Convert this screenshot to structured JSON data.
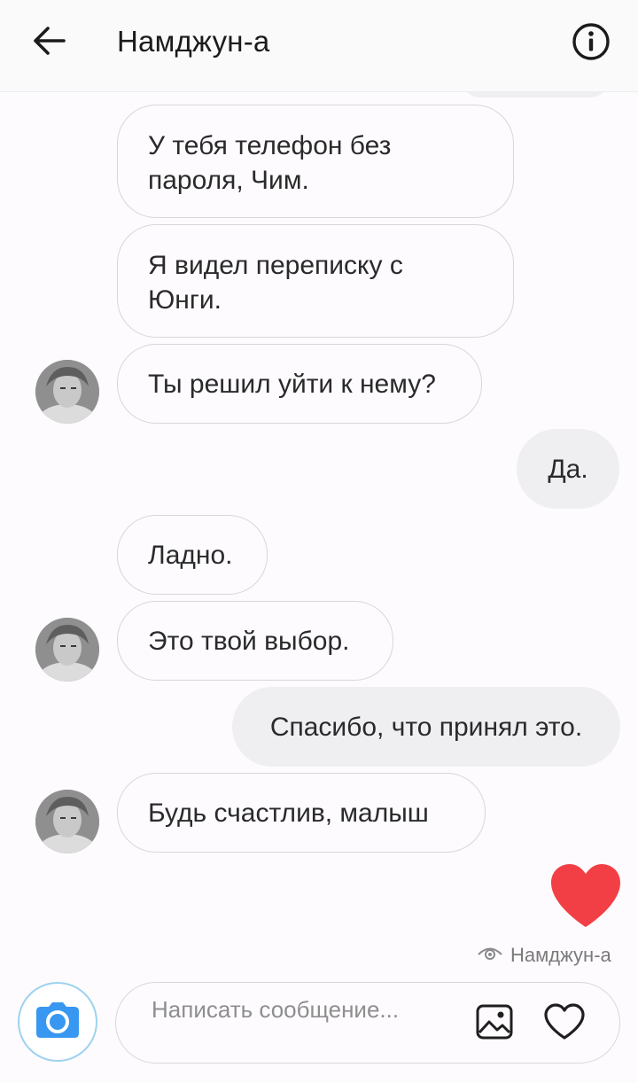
{
  "header": {
    "title": "Намджун-а",
    "back_icon": "arrow-left-icon",
    "info_icon": "info-circle-icon"
  },
  "messages": [
    {
      "side": "in",
      "text": "У тебя телефон без пароля, Чим."
    },
    {
      "side": "in",
      "text": "Я видел переписку с Юнги."
    },
    {
      "side": "in",
      "text": "Ты решил уйти к нему?"
    },
    {
      "side": "out",
      "text": "Да."
    },
    {
      "side": "in",
      "text": "Ладно."
    },
    {
      "side": "in",
      "text": "Это твой выбор."
    },
    {
      "side": "out",
      "text": "Спасибо, что принял это."
    },
    {
      "side": "in",
      "text": "Будь счастлив, малыш"
    }
  ],
  "reaction": {
    "icon": "heart-icon",
    "color": "#f23f45"
  },
  "seen": {
    "icon": "eye-icon",
    "label": "Намджун-а"
  },
  "composer": {
    "placeholder": "Написать сообщение...",
    "camera_icon": "camera-icon",
    "gallery_icon": "image-icon",
    "like_icon": "heart-outline-icon"
  },
  "colors": {
    "accent": "#3897f0",
    "heart": "#f23f45",
    "incoming_bubble_border": "#d8d6dc",
    "outgoing_bubble": "#efeef1"
  }
}
